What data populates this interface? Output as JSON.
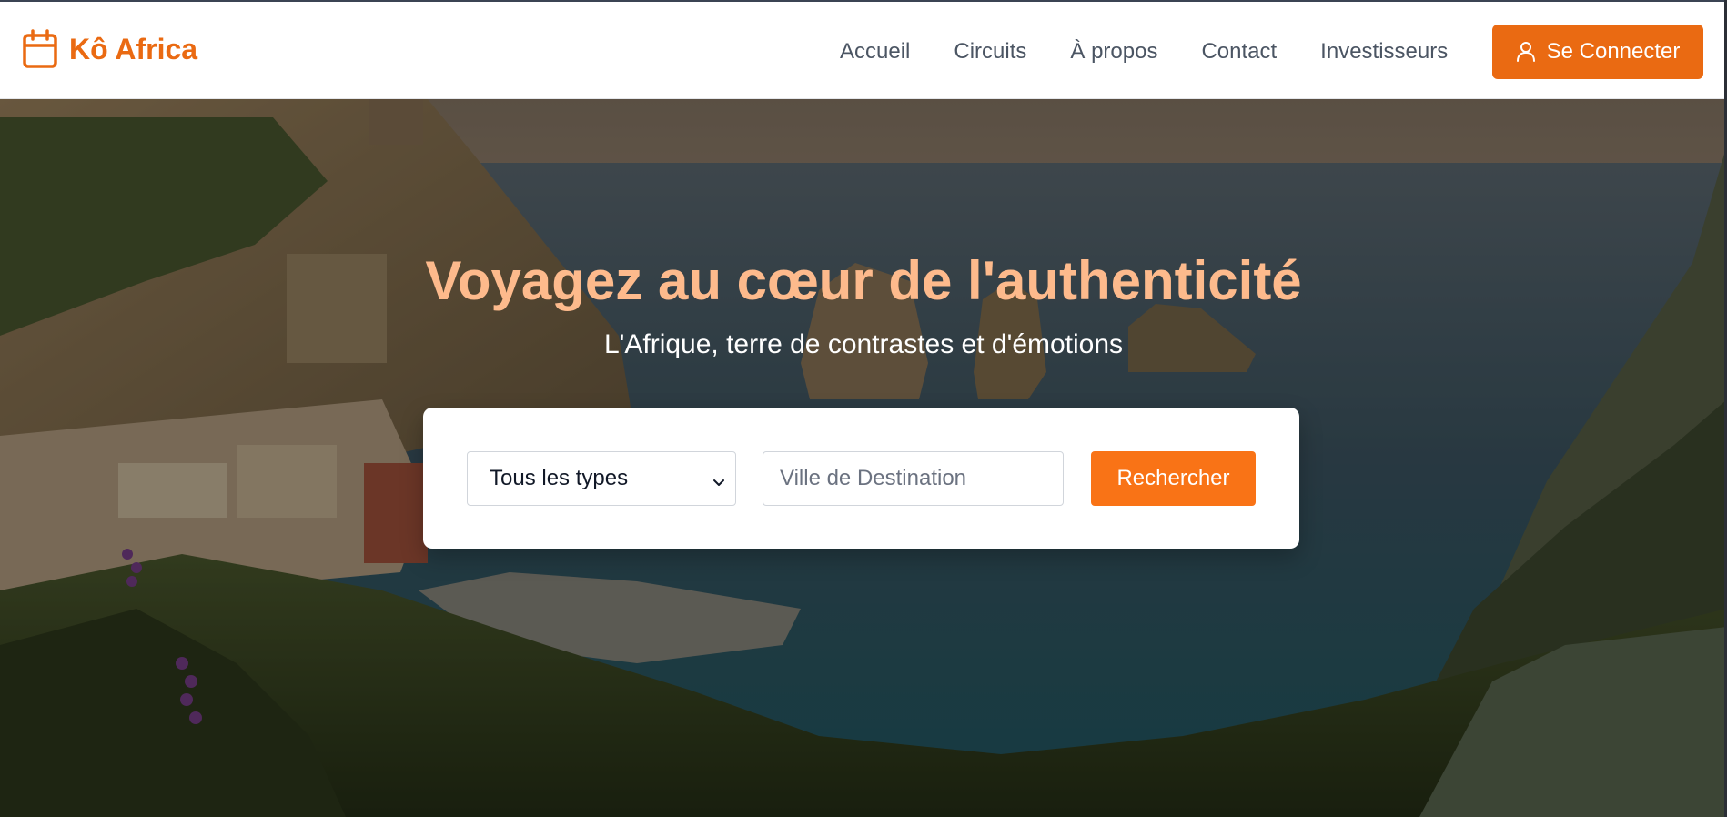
{
  "brand": {
    "name": "Kô Africa",
    "icon": "calendar-icon",
    "color": "#ea6a12"
  },
  "nav": {
    "items": [
      {
        "label": "Accueil"
      },
      {
        "label": "Circuits"
      },
      {
        "label": "À propos"
      },
      {
        "label": "Contact"
      },
      {
        "label": "Investisseurs"
      }
    ],
    "login_label": "Se Connecter",
    "login_icon": "user-icon"
  },
  "hero": {
    "title": "Voyagez au cœur de l'authenticité",
    "subtitle": "L'Afrique, terre de contrastes et d'émotions",
    "title_color": "#fdba8c"
  },
  "search": {
    "type_selected": "Tous les types",
    "destination_placeholder": "Ville de Destination",
    "destination_value": "",
    "submit_label": "Rechercher",
    "accent": "#f97316"
  }
}
